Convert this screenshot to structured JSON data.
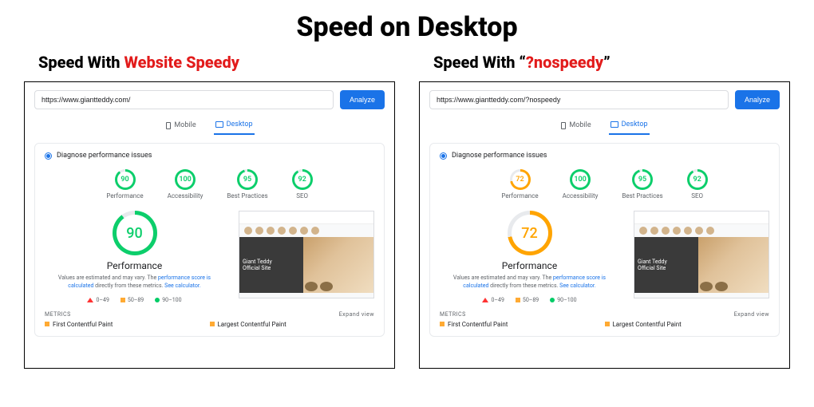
{
  "page_title": "Speed on Desktop",
  "left": {
    "title_prefix": "Speed With ",
    "title_red": "Website Speedy",
    "url": "https://www.giantteddy.com/",
    "analyze": "Analyze",
    "tabs": {
      "mobile": "Mobile",
      "desktop": "Desktop"
    },
    "diagnose": "Diagnose performance issues",
    "scores": [
      {
        "value": 90,
        "label": "Performance",
        "color": "#0cce6b"
      },
      {
        "value": 100,
        "label": "Accessibility",
        "color": "#0cce6b"
      },
      {
        "value": 95,
        "label": "Best Practices",
        "color": "#0cce6b"
      },
      {
        "value": 92,
        "label": "SEO",
        "color": "#0cce6b"
      }
    ],
    "big_score": {
      "value": 90,
      "label": "Performance",
      "color": "#0cce6b"
    },
    "note_a": "Values are estimated and may vary. The ",
    "note_link1": "performance score is calculated",
    "note_b": " directly from these metrics. ",
    "note_link2": "See calculator.",
    "legend": {
      "a": "0–49",
      "b": "50–89",
      "c": "90–100"
    },
    "preview": {
      "line1": "Giant Teddy",
      "line2": "Official Site"
    },
    "metrics_hdr": "METRICS",
    "expand": "Expand view",
    "m1": "First Contentful Paint",
    "m2": "Largest Contentful Paint"
  },
  "right": {
    "title_prefix": "Speed With “",
    "title_red": "?nospeedy",
    "title_suffix": "”",
    "url": "https://www.giantteddy.com/?nospeedy",
    "analyze": "Analyze",
    "tabs": {
      "mobile": "Mobile",
      "desktop": "Desktop"
    },
    "diagnose": "Diagnose performance issues",
    "scores": [
      {
        "value": 72,
        "label": "Performance",
        "color": "#ffa400"
      },
      {
        "value": 100,
        "label": "Accessibility",
        "color": "#0cce6b"
      },
      {
        "value": 95,
        "label": "Best Practices",
        "color": "#0cce6b"
      },
      {
        "value": 92,
        "label": "SEO",
        "color": "#0cce6b"
      }
    ],
    "big_score": {
      "value": 72,
      "label": "Performance",
      "color": "#ffa400"
    },
    "note_a": "Values are estimated and may vary. The ",
    "note_link1": "performance score is calculated",
    "note_b": " directly from these metrics. ",
    "note_link2": "See calculator.",
    "legend": {
      "a": "0–49",
      "b": "50–89",
      "c": "90–100"
    },
    "preview": {
      "line1": "Giant Teddy",
      "line2": "Official Site"
    },
    "metrics_hdr": "METRICS",
    "expand": "Expand view",
    "m1": "First Contentful Paint",
    "m2": "Largest Contentful Paint"
  }
}
